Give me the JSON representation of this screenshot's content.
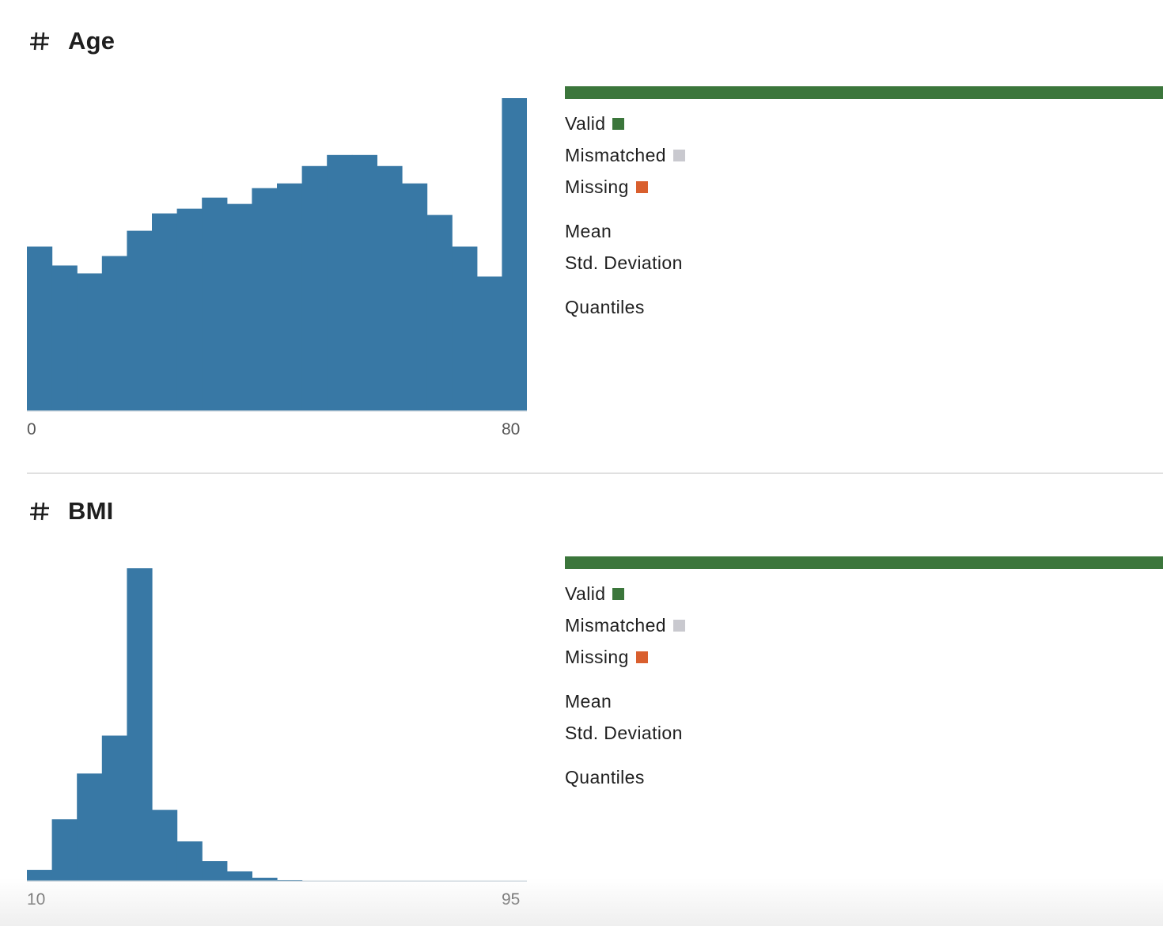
{
  "colors": {
    "bar": "#3878a5",
    "valid": "#3b763b",
    "mismatched": "#c9c9cf",
    "missing": "#d95f2e",
    "baseline": "#cfd8df"
  },
  "columns": [
    {
      "type_icon": "hash-icon",
      "name": "Age",
      "axis": {
        "min_label": "0",
        "max_label": "80"
      },
      "stats": {
        "valid_label": "Valid",
        "mismatched_label": "Mismatched",
        "missing_label": "Missing",
        "mean_label": "Mean",
        "std_label": "Std. Deviation",
        "quantiles_label": "Quantiles"
      },
      "validity": {
        "valid": 1.0,
        "mismatched": 0.0,
        "missing": 0.0
      }
    },
    {
      "type_icon": "hash-icon",
      "name": "BMI",
      "axis": {
        "min_label": "10",
        "max_label": "95"
      },
      "stats": {
        "valid_label": "Valid",
        "mismatched_label": "Mismatched",
        "missing_label": "Missing",
        "mean_label": "Mean",
        "std_label": "Std. Deviation",
        "quantiles_label": "Quantiles"
      },
      "validity": {
        "valid": 1.0,
        "mismatched": 0.0,
        "missing": 0.0
      }
    }
  ],
  "chart_data": [
    {
      "type": "bar",
      "title": "Age",
      "xlim": [
        0,
        80
      ],
      "values": [
        208,
        184,
        174,
        196,
        228,
        250,
        256,
        270,
        262,
        282,
        288,
        310,
        324,
        324,
        310,
        288,
        248,
        208,
        170,
        396
      ]
    },
    {
      "type": "bar",
      "title": "BMI",
      "xlim": [
        10,
        95
      ],
      "values": [
        14,
        78,
        136,
        184,
        396,
        90,
        50,
        25,
        12,
        4,
        1,
        0,
        0,
        0,
        0,
        0,
        0,
        0,
        0,
        0
      ]
    }
  ]
}
